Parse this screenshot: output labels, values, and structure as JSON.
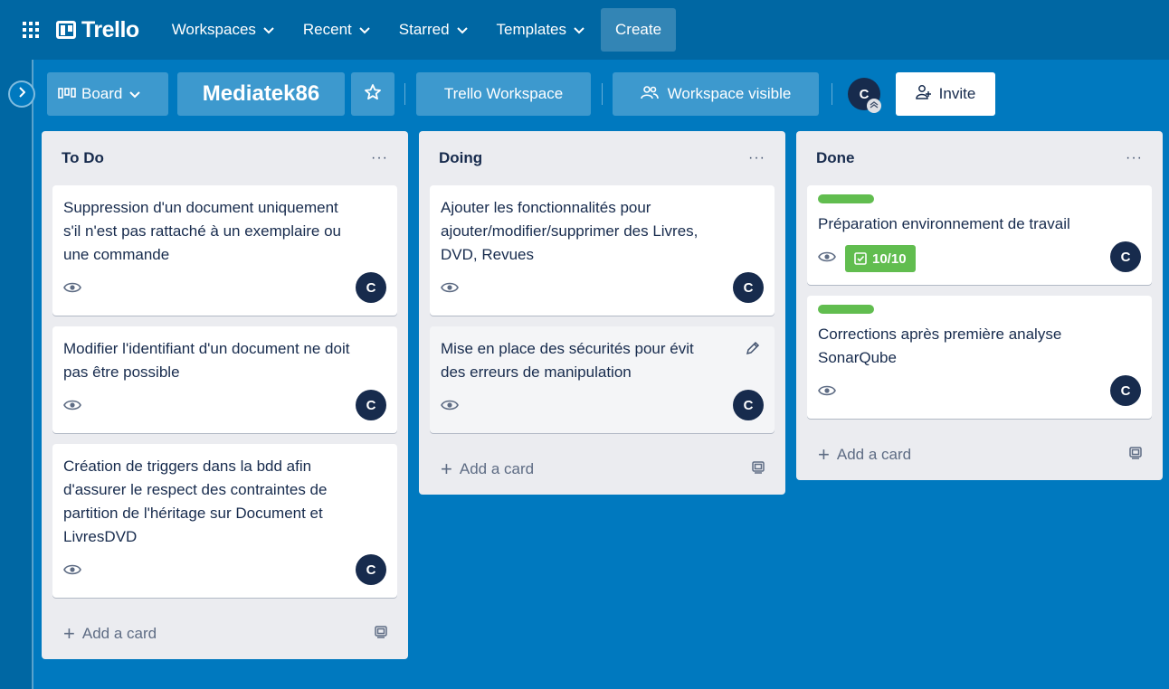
{
  "header": {
    "logo": "Trello",
    "nav": [
      {
        "label": "Workspaces"
      },
      {
        "label": "Recent"
      },
      {
        "label": "Starred"
      },
      {
        "label": "Templates"
      }
    ],
    "create_label": "Create"
  },
  "board_header": {
    "view_label": "Board",
    "board_name": "Mediatek86",
    "workspace_label": "Trello Workspace",
    "visibility_label": "Workspace visible",
    "member_initial": "C",
    "invite_label": "Invite"
  },
  "lists": [
    {
      "title": "To Do",
      "menu": "···",
      "add_label": "Add a card",
      "cards": [
        {
          "title": "Suppression d'un document uniquement s'il n'est pas rattaché à un exemplaire ou une commande",
          "avatar": "C"
        },
        {
          "title": "Modifier l'identifiant d'un document ne doit pas être possible",
          "avatar": "C"
        },
        {
          "title": "Création de triggers dans la bdd afin d'assurer le respect des contraintes de partition de l'héritage sur Document et LivresDVD",
          "avatar": "C"
        }
      ]
    },
    {
      "title": "Doing",
      "menu": "···",
      "add_label": "Add a card",
      "cards": [
        {
          "title": "Ajouter les fonctionnalités pour ajouter/modifier/supprimer des Livres, DVD, Revues",
          "avatar": "C"
        },
        {
          "title": "Mise en place des sécurités pour évit des erreurs de manipulation",
          "avatar": "C"
        }
      ]
    },
    {
      "title": "Done",
      "menu": "···",
      "add_label": "Add a card",
      "cards": [
        {
          "title": "Préparation environnement de travail",
          "avatar": "C",
          "label_color": "#61bd4f",
          "checklist": "10/10"
        },
        {
          "title": "Corrections après première analyse SonarQube",
          "avatar": "C",
          "label_color": "#61bd4f"
        }
      ]
    }
  ],
  "colors": {
    "board_bg": "#0079bf",
    "header_bg": "#0067a3",
    "list_bg": "#ebecf0",
    "label_green": "#61bd4f",
    "avatar_bg": "#172b4d"
  }
}
